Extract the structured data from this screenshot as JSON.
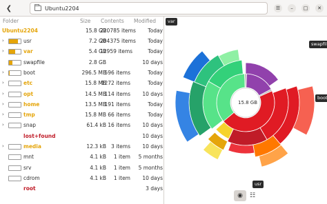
{
  "header": {
    "path": "Ubuntu2204",
    "back_icon": "go-back-icon",
    "folder_icon": "folder-icon"
  },
  "columns": {
    "folder": "Folder",
    "size": "Size",
    "contents": "Contents",
    "modified": "Modified"
  },
  "root": {
    "name": "Ubuntu2204",
    "size": "15.8 GB",
    "contents": "220785 items",
    "modified": "Today"
  },
  "rows": [
    {
      "name": "usr",
      "size": "7.2 GB",
      "contents": "204375 items",
      "modified": "Today",
      "expand": "›",
      "kind": "dir",
      "fill": 0.46,
      "color": "#e5a50a"
    },
    {
      "name": "var",
      "size": "5.4 GB",
      "contents": "12959 items",
      "modified": "Today",
      "expand": "›",
      "kind": "dir-orange",
      "fill": 0.34,
      "color": "#e5a50a"
    },
    {
      "name": "swapfile",
      "size": "2.8 GB",
      "contents": "",
      "modified": "10 days",
      "expand": "",
      "kind": "file",
      "fill": 0.18,
      "color": "#e5a50a"
    },
    {
      "name": "boot",
      "size": "296.5 MB",
      "contents": "596 items",
      "modified": "Today",
      "expand": "›",
      "kind": "dir",
      "fill": 0.02,
      "color": "#e5a50a"
    },
    {
      "name": "etc",
      "size": "15.8 MB",
      "contents": "1272 items",
      "modified": "Today",
      "expand": "›",
      "kind": "dir-orange",
      "fill": 0.0,
      "color": "#e5a50a"
    },
    {
      "name": "opt",
      "size": "14.5 MB",
      "contents": "114 items",
      "modified": "10 days",
      "expand": "›",
      "kind": "dir-orange",
      "fill": 0.0,
      "color": "#e5a50a"
    },
    {
      "name": "home",
      "size": "13.5 MB",
      "contents": "191 items",
      "modified": "Today",
      "expand": "›",
      "kind": "dir-orange",
      "fill": 0.0,
      "color": "#e5a50a"
    },
    {
      "name": "tmp",
      "size": "15.8 MB",
      "contents": "66 items",
      "modified": "Today",
      "expand": "›",
      "kind": "dir-orange",
      "fill": 0.0,
      "color": "#e5a50a"
    },
    {
      "name": "snap",
      "size": "61.4 kB",
      "contents": "16 items",
      "modified": "10 days",
      "expand": "›",
      "kind": "dir",
      "fill": 0.0,
      "color": "#e5a50a"
    },
    {
      "name": "lost+found",
      "size": "",
      "contents": "",
      "modified": "10 days",
      "expand": "",
      "kind": "dir-red",
      "fill": null,
      "color": "#e5a50a"
    },
    {
      "name": "media",
      "size": "12.3 kB",
      "contents": "3 items",
      "modified": "10 days",
      "expand": "›",
      "kind": "dir-orange",
      "fill": 0.0,
      "color": "#e5a50a"
    },
    {
      "name": "mnt",
      "size": "4.1 kB",
      "contents": "1 item",
      "modified": "5 months",
      "expand": "",
      "kind": "dir",
      "fill": 0.0,
      "color": "#e5a50a"
    },
    {
      "name": "srv",
      "size": "4.1 kB",
      "contents": "1 item",
      "modified": "5 months",
      "expand": "",
      "kind": "dir",
      "fill": 0.0,
      "color": "#e5a50a"
    },
    {
      "name": "cdrom",
      "size": "4.1 kB",
      "contents": "1 item",
      "modified": "10 days",
      "expand": "",
      "kind": "dir",
      "fill": 0.0,
      "color": "#e5a50a"
    },
    {
      "name": "root",
      "size": "",
      "contents": "",
      "modified": "3 days",
      "expand": "",
      "kind": "dir-red",
      "fill": null,
      "color": "#e5a50a"
    }
  ],
  "chart": {
    "center_label": "15.8 GB",
    "labels": {
      "var": "var",
      "swapfile": "swapfile",
      "boot": "boot",
      "usr": "usr"
    },
    "colors": {
      "var": "#57e389",
      "var_outer": "#26a269",
      "var_blue": "#3584e4",
      "usr": "#e01b24",
      "usr_outer": "#ff7800",
      "usr_yellow": "#f6d32d",
      "swapfile": "#9141ac",
      "boot": "#c0bfbc",
      "center": "#ffffff"
    },
    "view_buttons": [
      "chart-view-icon",
      "list-view-icon"
    ]
  }
}
